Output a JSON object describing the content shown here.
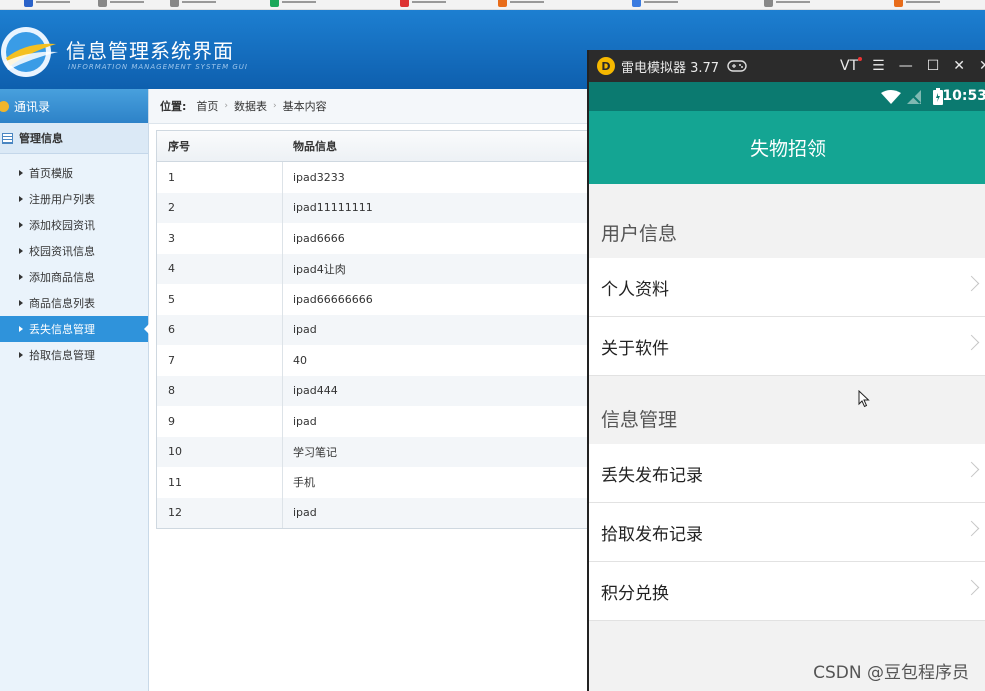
{
  "header": {
    "title": "信息管理系统界面",
    "subtitle": "INFORMATION MANAGEMENT SYSTEM GUI"
  },
  "sidebar": {
    "top": "通讯录",
    "group": "管理信息",
    "items": [
      {
        "label": "首页模版"
      },
      {
        "label": "注册用户列表"
      },
      {
        "label": "添加校园资讯"
      },
      {
        "label": "校园资讯信息"
      },
      {
        "label": "添加商品信息"
      },
      {
        "label": "商品信息列表"
      },
      {
        "label": "丢失信息管理"
      },
      {
        "label": "拾取信息管理"
      }
    ]
  },
  "breadcrumb": {
    "label": "位置:",
    "items": [
      "首页",
      "数据表",
      "基本内容"
    ]
  },
  "table": {
    "headers": [
      "序号",
      "物品信息"
    ],
    "rows": [
      [
        "1",
        "ipad3233"
      ],
      [
        "2",
        "ipad11111111"
      ],
      [
        "3",
        "ipad6666"
      ],
      [
        "4",
        "ipad4让肉"
      ],
      [
        "5",
        "ipad66666666"
      ],
      [
        "6",
        "ipad"
      ],
      [
        "7",
        "40"
      ],
      [
        "8",
        "ipad444"
      ],
      [
        "9",
        "ipad"
      ],
      [
        "10",
        "学习笔记"
      ],
      [
        "11",
        "手机"
      ],
      [
        "12",
        "ipad"
      ]
    ]
  },
  "emulator": {
    "title": "雷电模拟器 3.77",
    "vt": "VT",
    "time": "10:53",
    "app_title": "失物招领",
    "sections": [
      {
        "heading": "用户信息",
        "items": [
          "个人资料",
          "关于软件"
        ]
      },
      {
        "heading": "信息管理",
        "items": [
          "丢失发布记录",
          "拾取发布记录",
          "积分兑换"
        ]
      }
    ]
  },
  "watermark": "CSDN @豆包程序员",
  "colors": {
    "header_blue": "#1d7fd1",
    "sidebar_active": "#2f93db",
    "app_teal": "#14a593",
    "status_teal": "#0b7a70"
  }
}
